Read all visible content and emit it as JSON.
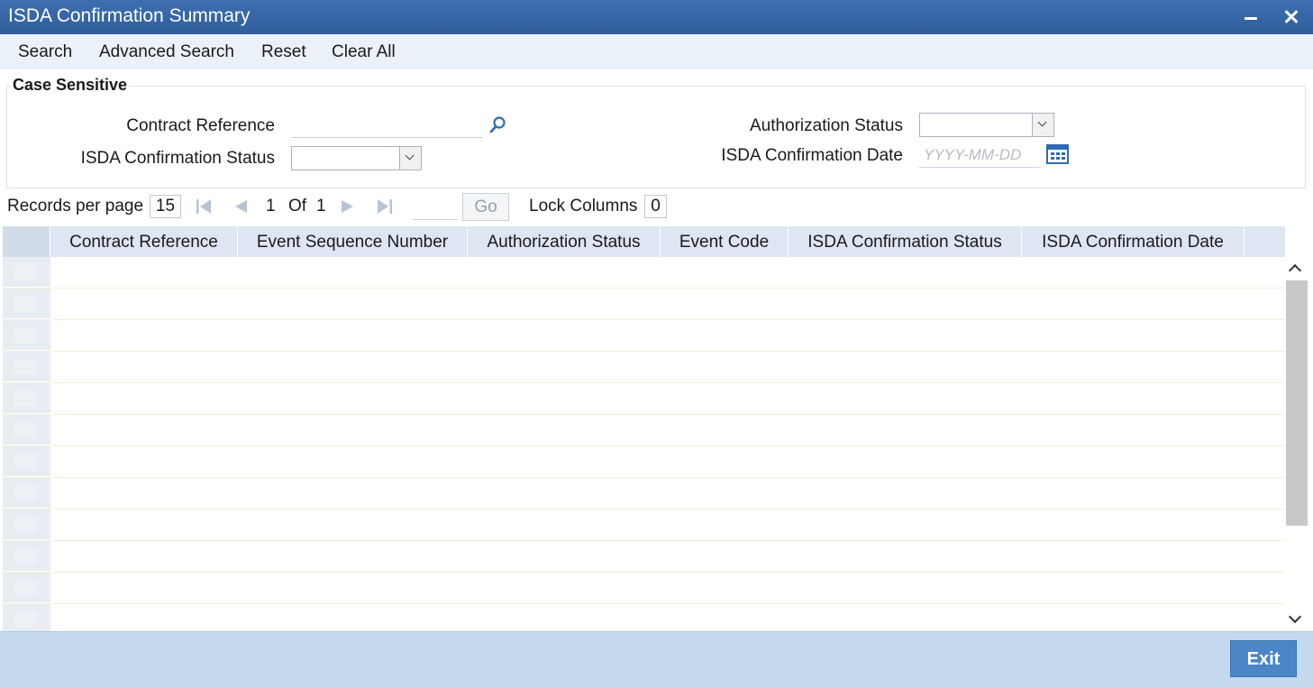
{
  "window": {
    "title": "ISDA Confirmation Summary"
  },
  "toolbar": {
    "search": "Search",
    "advanced_search": "Advanced Search",
    "reset": "Reset",
    "clear_all": "Clear All"
  },
  "criteria": {
    "legend": "Case Sensitive",
    "contract_reference_label": "Contract Reference",
    "contract_reference_value": "",
    "isda_confirmation_status_label": "ISDA Confirmation Status",
    "isda_confirmation_status_value": "",
    "authorization_status_label": "Authorization Status",
    "authorization_status_value": "",
    "isda_confirmation_date_label": "ISDA Confirmation Date",
    "isda_confirmation_date_placeholder": "YYYY-MM-DD"
  },
  "pager": {
    "records_per_page_label": "Records per page",
    "records_per_page": "15",
    "current_page": "1",
    "of_label": "Of",
    "total_pages": "1",
    "go_label": "Go",
    "lock_columns_label": "Lock Columns",
    "lock_columns_value": "0"
  },
  "grid": {
    "columns": [
      "Contract Reference",
      "Event Sequence Number",
      "Authorization Status",
      "Event Code",
      "ISDA Confirmation Status",
      "ISDA Confirmation Date"
    ]
  },
  "footer": {
    "exit_label": "Exit"
  },
  "colors": {
    "titlebar": "#2f5d9c",
    "toolbar": "#ebf1f9",
    "grid_header": "#dde6f2",
    "footer": "#c4d9ee",
    "exit_button": "#4c86c6"
  }
}
